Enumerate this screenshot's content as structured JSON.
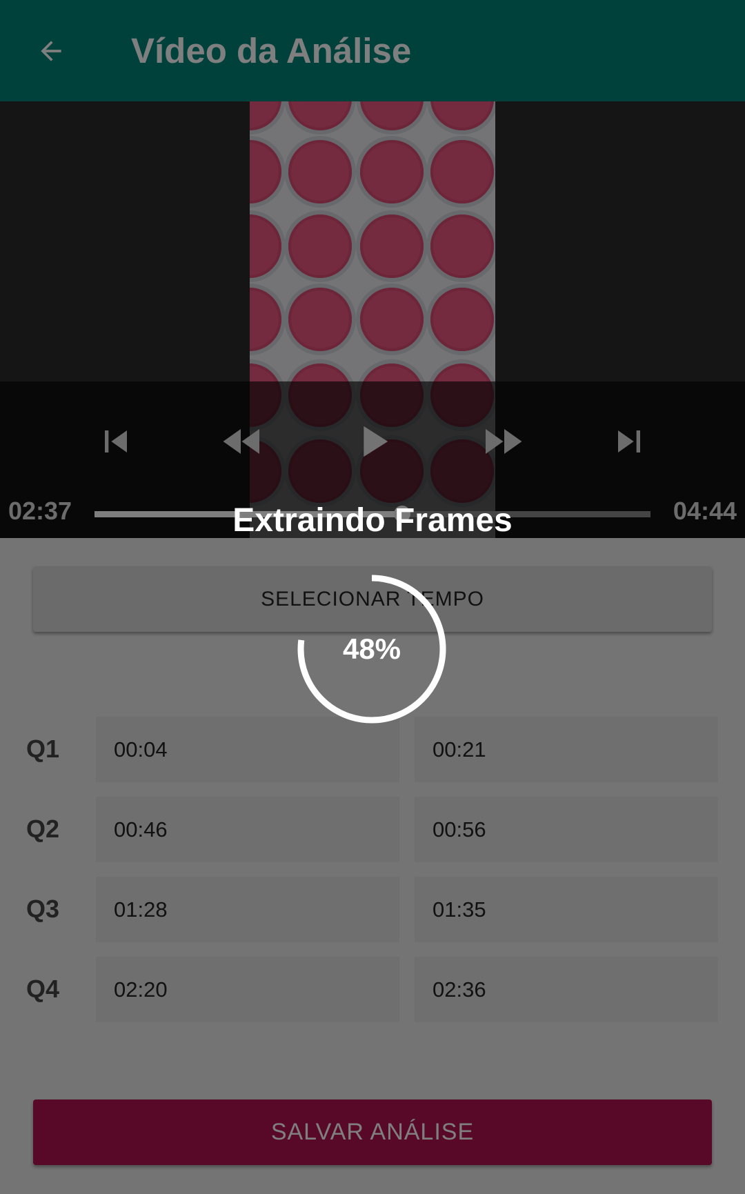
{
  "app_bar": {
    "title": "Vídeo da Análise",
    "back_icon": "arrow-back-icon",
    "background_color": "#008577"
  },
  "player": {
    "controls": [
      {
        "name": "skip-previous-icon"
      },
      {
        "name": "rewind-icon"
      },
      {
        "name": "play-icon"
      },
      {
        "name": "fast-forward-icon"
      },
      {
        "name": "skip-next-icon"
      }
    ],
    "current_time": "02:37",
    "total_time": "04:44",
    "progress_fraction": 0.553
  },
  "select_time_button": {
    "label": "SELECIONAR TEMPO"
  },
  "quadrants": [
    {
      "label": "Q1",
      "start": "00:04",
      "end": "00:21"
    },
    {
      "label": "Q2",
      "start": "00:46",
      "end": "00:56"
    },
    {
      "label": "Q3",
      "start": "01:28",
      "end": "01:35"
    },
    {
      "label": "Q4",
      "start": "02:20",
      "end": "02:36"
    }
  ],
  "save_button": {
    "label": "SALVAR ANÁLISE",
    "color": "#b0124e"
  },
  "progress_overlay": {
    "title": "Extraindo Frames",
    "percent_text": "48%",
    "percent_value": 48
  }
}
